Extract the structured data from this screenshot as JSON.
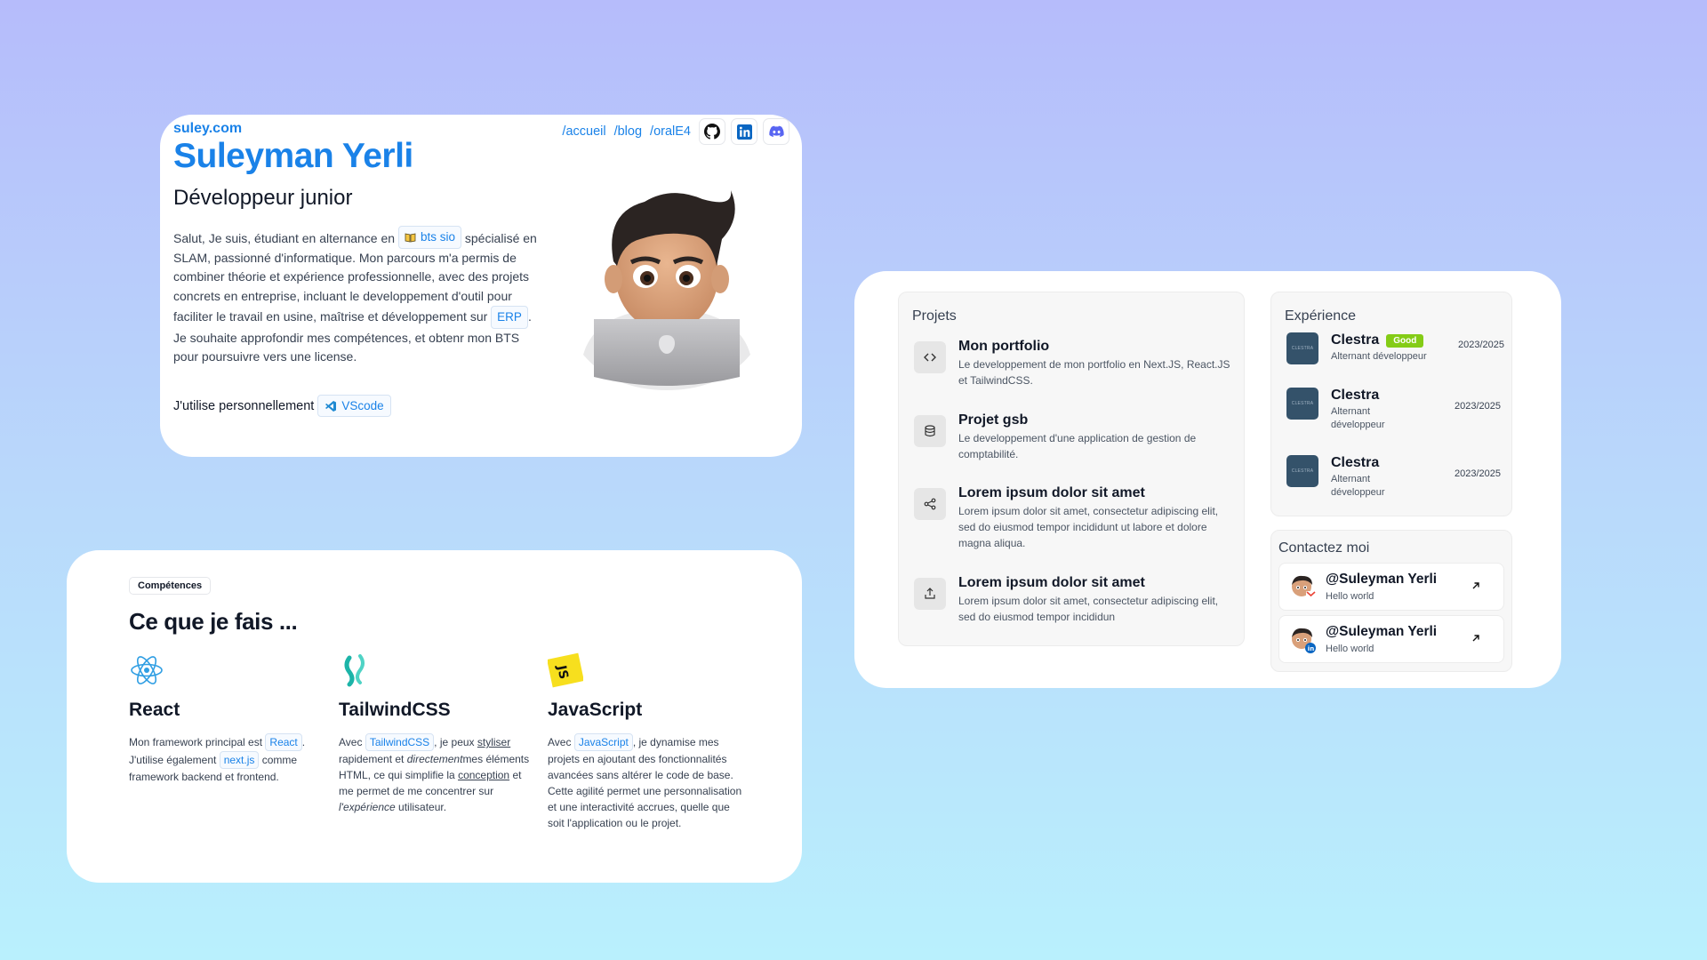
{
  "hero": {
    "site": "suley.com",
    "name": "Suleyman Yerli",
    "role": "Développeur junior",
    "bio": {
      "p1": "Salut, Je suis, étudiant en alternance en",
      "chip1": "bts sio",
      "p2": "spécialisé en SLAM, passionné d'informatique. Mon parcours m'a permis de combiner théorie et expérience professionnelle, avec des projets concrets en entreprise, incluant le developpement d'outil pour faciliter le travail en usine, maîtrise et développement sur",
      "chip2": "ERP",
      "p3": ". Je souhaite approfondir mes compétences, et obtenr mon BTS pour poursuivre vers une license."
    },
    "tool_text": "J'utilise personnellement",
    "tool_chip": "VScode",
    "nav": [
      "/accueil",
      "/blog",
      "/oralE4"
    ]
  },
  "skills": {
    "tag": "Compétences",
    "title": "Ce que je fais ...",
    "react": {
      "title": "React",
      "t1": "Mon framework principal est",
      "c1": "React",
      "t2": ". J'utilise également",
      "c2": "next.js",
      "t3": "comme framework backend et frontend."
    },
    "tailwind": {
      "title": "TailwindCSS",
      "t1": "Avec",
      "c1": "TailwindCSS",
      "t2": ", je peux",
      "u1": "styliser",
      "t3": "rapidement et",
      "i1": "directement",
      "t4": "mes éléments HTML, ce qui simplifie la",
      "u2": "conception",
      "t5": "et me permet de me concentrer sur",
      "i2": "l'expérience",
      "t6": "utilisateur."
    },
    "javascript": {
      "title": "JavaScript",
      "t1": "Avec",
      "c1": "JavaScript",
      "t2": ", je dynamise mes projets en ajoutant des fonctionnalités avancées sans altérer le code de base. Cette agilité permet une personnalisation et une interactivité accrues, quelle que soit l'application ou le projet."
    }
  },
  "projects": {
    "title": "Projets",
    "items": [
      {
        "title": "Mon portfolio",
        "desc": "Le developpement de mon portfolio en Next.JS, React.JS et TailwindCSS.",
        "icon": "code-icon"
      },
      {
        "title": "Projet gsb",
        "desc": "Le developpement d'une application de gestion de comptabilité.",
        "icon": "database-icon"
      },
      {
        "title": "Lorem ipsum dolor sit amet",
        "desc": "Lorem ipsum dolor sit amet, consectetur adipiscing elit, sed do eiusmod tempor incididunt ut labore et dolore magna aliqua.",
        "icon": "share-icon"
      },
      {
        "title": "Lorem ipsum dolor sit amet",
        "desc": "Lorem ipsum dolor sit amet, consectetur adipiscing elit, sed do eiusmod tempor incididun",
        "icon": "upload-icon"
      }
    ]
  },
  "experience": {
    "title": "Expérience",
    "items": [
      {
        "company": "Clestra",
        "badge": "Good",
        "role": "Alternant développeur",
        "date": "2023/2025",
        "logo": "CLESTRA"
      },
      {
        "company": "Clestra",
        "role": "Alternant développeur",
        "date": "2023/2025",
        "logo": "CLESTRA"
      },
      {
        "company": "Clestra",
        "role": "Alternant développeur",
        "date": "2023/2025",
        "logo": "CLESTRA"
      }
    ]
  },
  "contact": {
    "title": "Contactez moi",
    "items": [
      {
        "handle": "@Suleyman Yerli",
        "text": "Hello world",
        "icon": "gmail-icon"
      },
      {
        "handle": "@Suleyman Yerli",
        "text": "Hello world",
        "icon": "linkedin-icon"
      }
    ]
  },
  "colors": {
    "accent": "#1a82e8",
    "badge": "#84cc16",
    "logo_bg": "#34526a"
  }
}
